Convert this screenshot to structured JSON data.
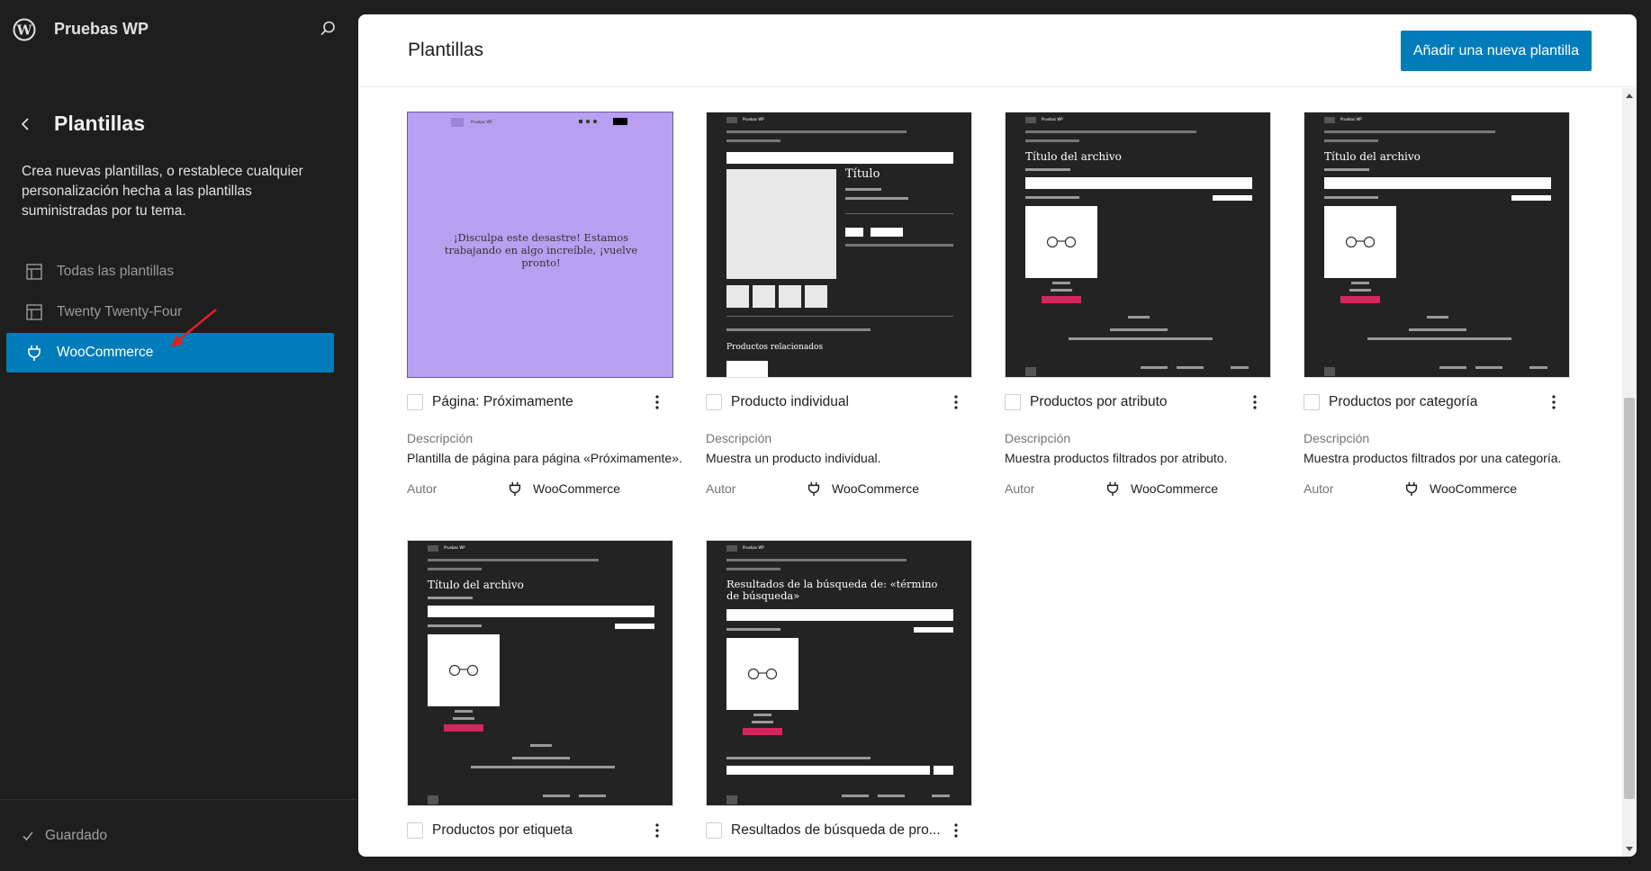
{
  "sidebar": {
    "site_name": "Pruebas WP",
    "title": "Plantillas",
    "description": "Crea nuevas plantillas, o restablece cualquier personalización hecha a las plantillas suministradas por tu tema.",
    "items": [
      {
        "label": "Todas las plantillas",
        "icon": "layout-icon",
        "active": false
      },
      {
        "label": "Twenty Twenty-Four",
        "icon": "layout-icon",
        "active": false
      },
      {
        "label": "WooCommerce",
        "icon": "plugin-icon",
        "active": true
      }
    ],
    "status": "Guardado"
  },
  "main": {
    "title": "Plantillas",
    "add_button": "Añadir una nueva plantilla",
    "description_label": "Descripción",
    "author_label": "Autor",
    "templates": [
      {
        "name": "Página: Próximamente",
        "description": "Plantilla de página para página «Próximamente».",
        "author": "WooCommerce"
      },
      {
        "name": "Producto individual",
        "description": "Muestra un producto individual.",
        "author": "WooCommerce"
      },
      {
        "name": "Productos por atributo",
        "description": "Muestra productos filtrados por atributo.",
        "author": "WooCommerce"
      },
      {
        "name": "Productos por categoría",
        "description": "Muestra productos filtrados por una categoría.",
        "author": "WooCommerce"
      },
      {
        "name": "Productos por etiqueta"
      },
      {
        "name": "Resultados de búsqueda de pro..."
      }
    ]
  },
  "previews": {
    "site": "Pruebas WP",
    "coming_soon": "¡Disculpa este desastre! Estamos trabajando en algo increíble, ¡vuelve pronto!",
    "product_title": "Título",
    "archive_title": "Título del archivo",
    "search_title": "Resultados de la búsqueda de: «término de búsqueda»",
    "related": "Productos relacionados"
  },
  "colors": {
    "accent": "#007cba",
    "sidebar_bg": "#1e1e1e",
    "coming_soon_bg": "#b89ff0",
    "preview_bg": "#232323",
    "sale_button": "#d6245d",
    "annotation_arrow": "#e02020"
  }
}
